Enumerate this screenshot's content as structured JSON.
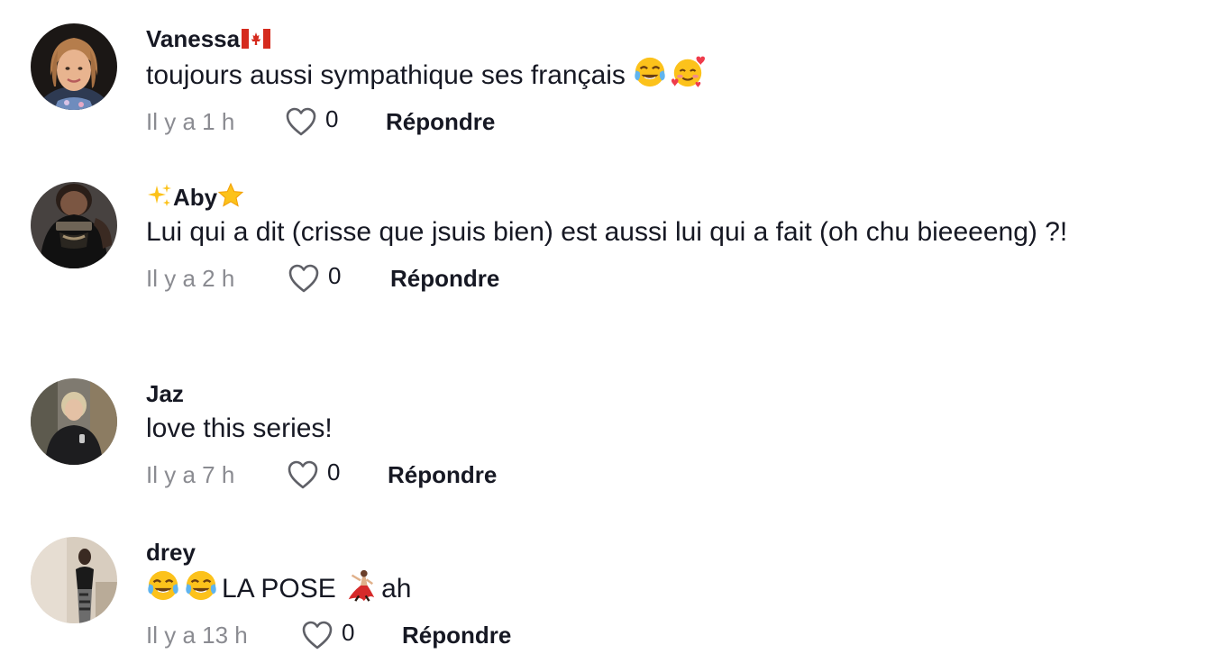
{
  "comments": [
    {
      "username": "Vanessa",
      "username_suffix_icon": "canada-flag",
      "text": "toujours aussi sympathique ses français",
      "text_trailing_emojis": [
        "face-with-tears-of-joy",
        "smiling-face-with-hearts"
      ],
      "time": "Il y a 1 h",
      "likes": "0",
      "reply_label": "Répondre"
    },
    {
      "username_prefix_icon": "sparkles",
      "username": "Aby",
      "username_suffix_icon": "star",
      "text": "Lui qui a dit (crisse que jsuis bien) est aussi lui qui a fait (oh chu bieeeeng) ?!",
      "time": "Il y a 2 h",
      "likes": "0",
      "reply_label": "Répondre"
    },
    {
      "username": "Jaz",
      "text": "love this series!",
      "time": "Il y a 7 h",
      "likes": "0",
      "reply_label": "Répondre"
    },
    {
      "username": "drey",
      "text_leading_emojis": [
        "face-with-tears-of-joy",
        "face-with-tears-of-joy"
      ],
      "text_part1": "LA POSE",
      "text_mid_emoji": "woman-dancing",
      "text_part2": "ah",
      "time": "Il y a 13 h",
      "likes": "0",
      "reply_label": "Répondre"
    }
  ],
  "colors": {
    "text_primary": "#161823",
    "text_secondary": "#8a8b91",
    "background": "#ffffff"
  }
}
